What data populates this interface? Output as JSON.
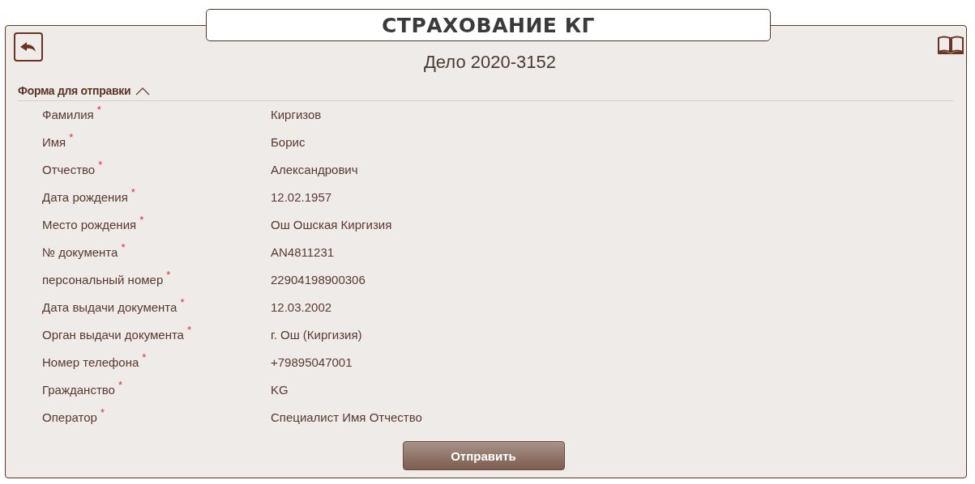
{
  "header": {
    "title": "СТРАХОВАНИЕ КГ"
  },
  "case_title": "Дело 2020-3152",
  "section": {
    "title": "Форма для отправки",
    "expanded": true
  },
  "fields": [
    {
      "label": "Фамилия",
      "mark": "*",
      "value": "Киргизов"
    },
    {
      "label": "Имя",
      "mark": "*",
      "value": "Борис"
    },
    {
      "label": "Отчество",
      "mark": "*",
      "value": "Александрович"
    },
    {
      "label": "Дата рождения",
      "mark": "*",
      "value": "12.02.1957"
    },
    {
      "label": "Место рождения",
      "mark": "*",
      "value": "Ош Ошская Киргизия"
    },
    {
      "label": "№ документа",
      "mark": "*",
      "value": "AN4811231"
    },
    {
      "label": "персональный номер",
      "mark": "*",
      "value": "22904198900306"
    },
    {
      "label": "Дата выдачи документа",
      "mark": "*",
      "value": "12.03.2002"
    },
    {
      "label": "Орган выдачи документа",
      "mark": "*",
      "value": "г. Ош (Киргизия)"
    },
    {
      "label": "Номер телефона",
      "mark": "*",
      "value": "+79895047001"
    },
    {
      "label": "Гражданство",
      "mark": "*",
      "value": "KG"
    },
    {
      "label": "Оператор",
      "mark": "*",
      "value": "Специалист Имя Отчество"
    }
  ],
  "submit_button": "Отправить"
}
